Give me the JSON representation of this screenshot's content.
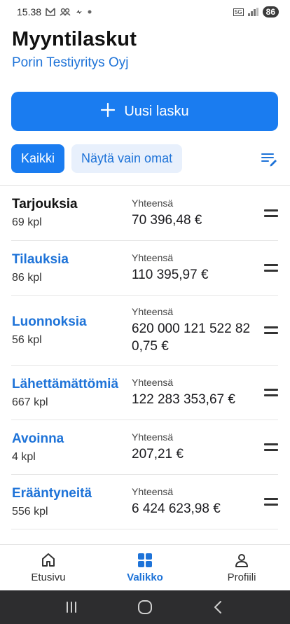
{
  "status_bar": {
    "time": "15.38",
    "network": "5G",
    "battery": "86"
  },
  "header": {
    "title": "Myyntilaskut",
    "company": "Porin Testiyritys Oyj"
  },
  "new_invoice_button": {
    "label": "Uusi lasku"
  },
  "filters": {
    "all_label": "Kaikki",
    "own_label": "Näytä vain omat",
    "active": "all"
  },
  "rows": [
    {
      "name": "Tarjouksia",
      "count": "69 kpl",
      "total_label": "Yhteensä",
      "total": "70 396,48 €",
      "highlight": false
    },
    {
      "name": "Tilauksia",
      "count": "86 kpl",
      "total_label": "Yhteensä",
      "total": "110 395,97 €",
      "highlight": true
    },
    {
      "name": "Luonnoksia",
      "count": "56 kpl",
      "total_label": "Yhteensä",
      "total": "620 000 121 522 820,75 €",
      "highlight": true
    },
    {
      "name": "Lähettämättömiä",
      "count": "667 kpl",
      "total_label": "Yhteensä",
      "total": "122 283 353,67 €",
      "highlight": true
    },
    {
      "name": "Avoinna",
      "count": "4 kpl",
      "total_label": "Yhteensä",
      "total": "207,21 €",
      "highlight": true
    },
    {
      "name": "Erääntyneitä",
      "count": "556 kpl",
      "total_label": "Yhteensä",
      "total": "6 424 623,98 €",
      "highlight": true
    }
  ],
  "bottom_nav": [
    {
      "label": "Etusivu",
      "icon": "home-icon",
      "active": false
    },
    {
      "label": "Valikko",
      "icon": "grid-icon",
      "active": true
    },
    {
      "label": "Profiili",
      "icon": "person-icon",
      "active": false
    }
  ],
  "colors": {
    "accent": "#1a7cf0",
    "link": "#1e73d8",
    "chip_inactive_bg": "#e8f0fc",
    "system_nav_bg": "#2d2d2f"
  }
}
